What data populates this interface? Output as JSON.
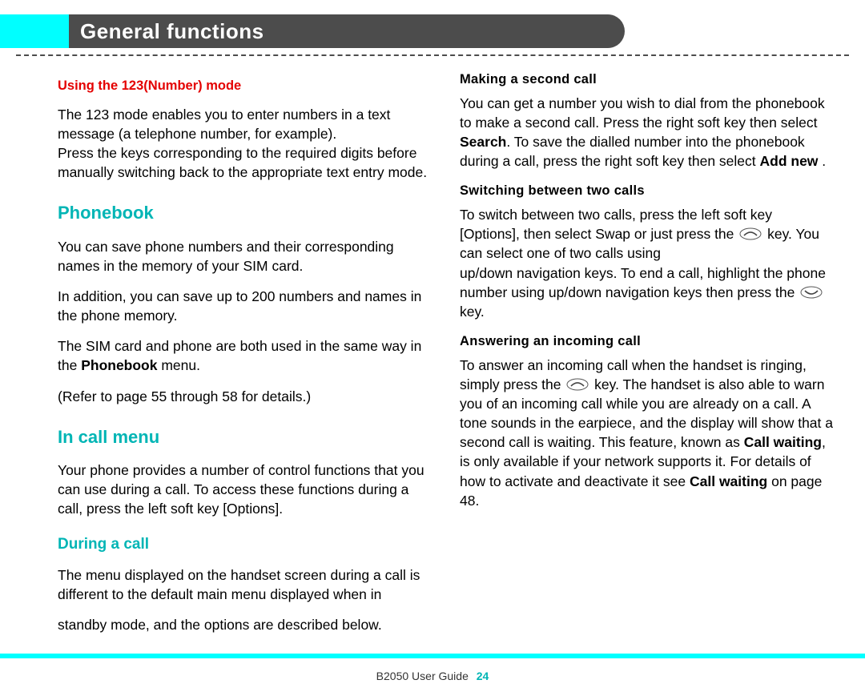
{
  "header": {
    "title": "General functions"
  },
  "left": {
    "sub_red_1": "Using the 123(Number) mode",
    "p1a": "The 123 mode enables you to enter numbers in a text message (a telephone number, for example).",
    "p1b": "Press the keys corresponding to the required digits before manually switching back to the appropriate text entry mode.",
    "sec_cyan_1": "Phonebook",
    "p2": "You can save phone numbers and their corresponding names in the memory of your SIM card.",
    "p3": "In addition, you can save up to 200 numbers and names in the phone memory.",
    "p4_pre": "The SIM card and phone are both used in the same way in the ",
    "p4_bold": "Phonebook",
    "p4_post": " menu.",
    "p5": "(Refer to page 55 through 58 for details.)",
    "sec_cyan_2": "In call menu",
    "p6": "Your phone provides a number of control functions that you can use during a call. To access these functions during a call, press the left soft key [Options].",
    "sub_cyan_1": "During a call",
    "p7": "The menu displayed on the handset screen during a call is different to the default main menu displayed when in"
  },
  "right": {
    "p8": "standby mode, and the options are described below.",
    "hb1": "Making a second call",
    "p9_a": "You can get a number you wish to dial from the phonebook to make a second call. Press the right soft key then select ",
    "p9_b": "Search",
    "p9_c": ". To save the dialled number into the phonebook during a call, press the right soft key then select ",
    "p9_d": "Add new",
    "p9_e": " .",
    "hb2": "Switching between two calls",
    "p10_a": "To switch between two calls, press the left soft key [Options], then select Swap or just press the ",
    "p10_b": " key. You can select one of two calls using",
    "p10_c": "up/down navigation keys. To end a call, highlight the phone number using up/down navigation keys then press the ",
    "p10_d": " key.",
    "hb3": "Answering an incoming call",
    "p11_a": "To answer an incoming call when the handset is ringing, simply press the ",
    "p11_b": " key. The handset is also able to warn you of an incoming call while you are already on a call. A tone sounds in the earpiece, and the display will show that a second call is waiting. This feature, known as ",
    "p11_c": "Call waiting",
    "p11_d": ", is only available if your network supports it. For details of how to activate and deactivate it see ",
    "p11_e": "Call waiting",
    "p11_f": " on page 48."
  },
  "footer": {
    "guide": "B2050 User Guide",
    "page": "24"
  }
}
